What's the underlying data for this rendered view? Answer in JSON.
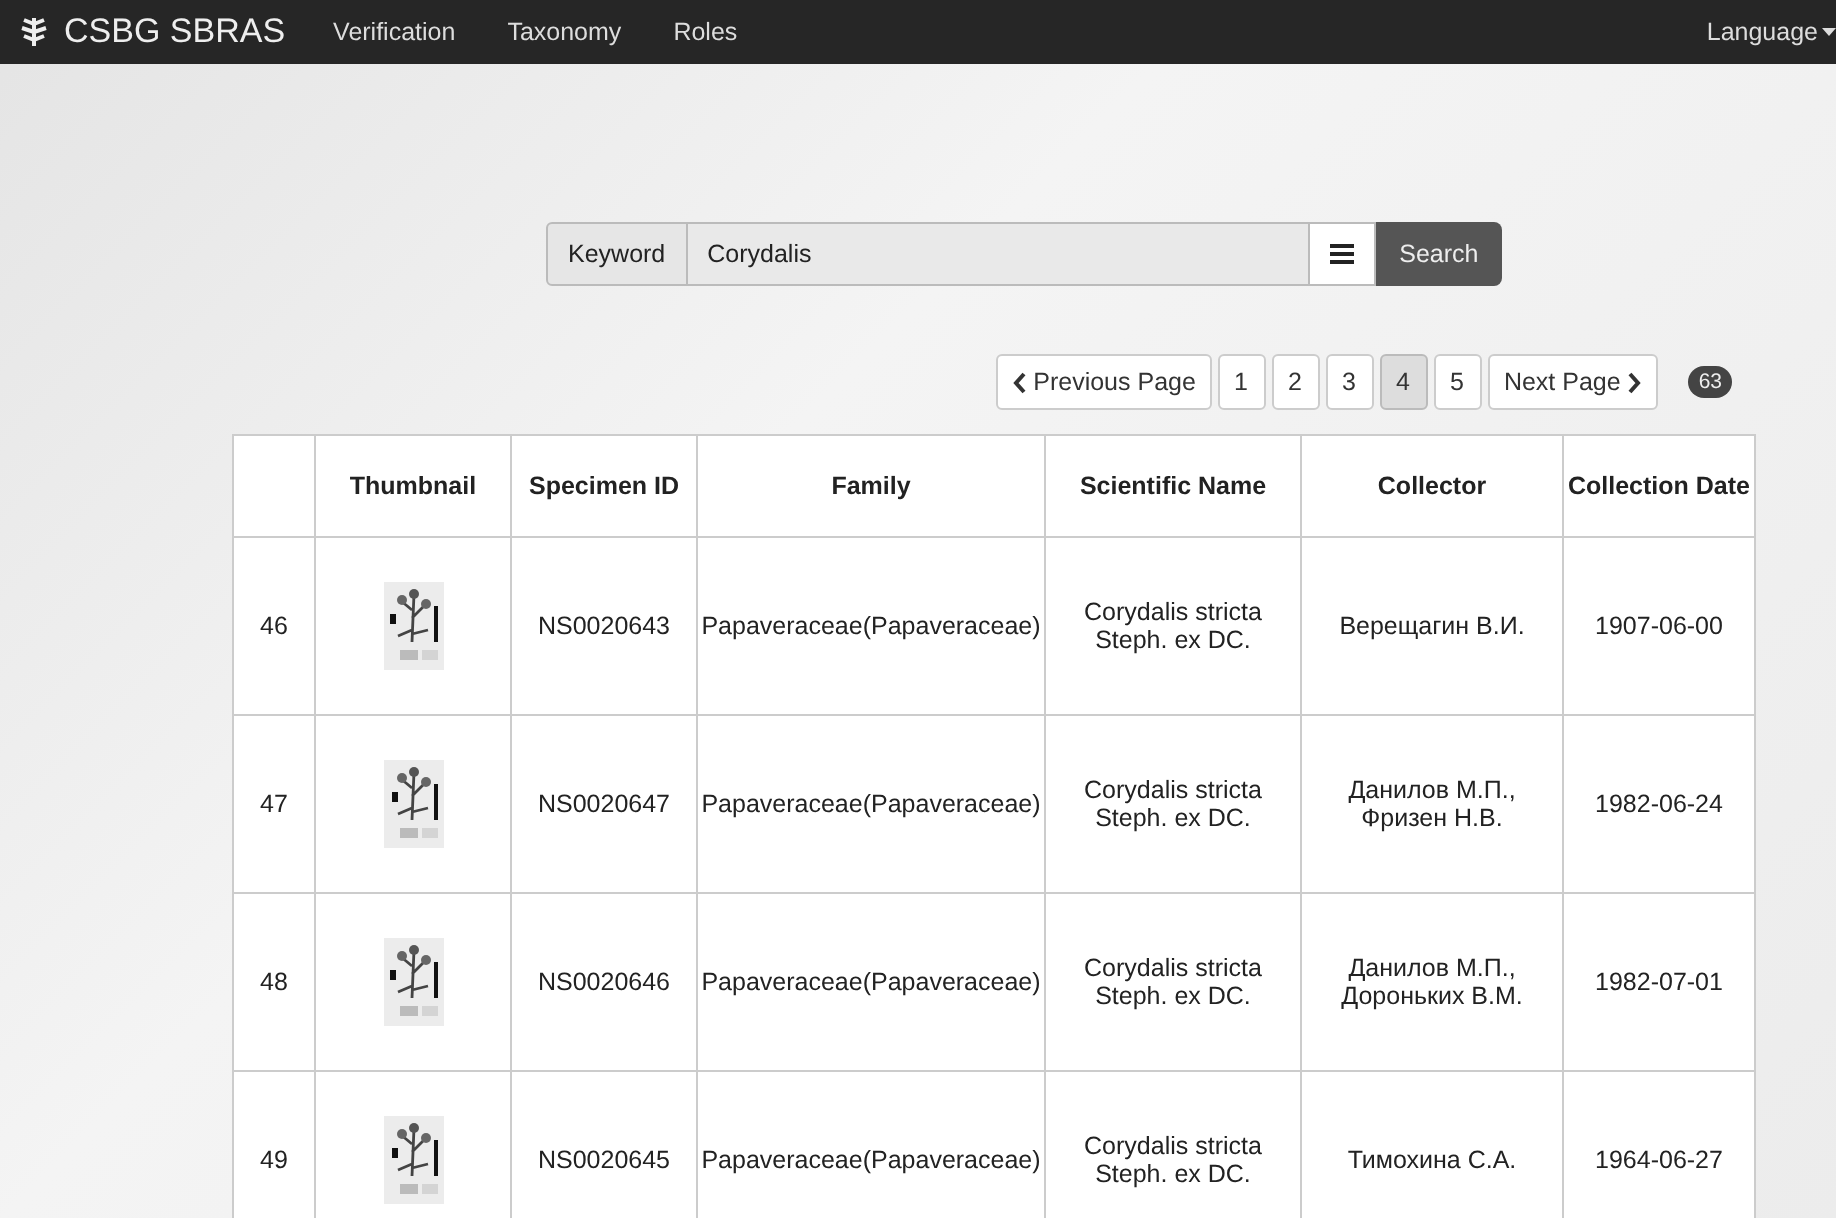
{
  "navbar": {
    "brand": "CSBG SBRAS",
    "links": [
      {
        "label": "Verification"
      },
      {
        "label": "Taxonomy"
      },
      {
        "label": "Roles"
      }
    ],
    "language": "Language"
  },
  "search": {
    "label": "Keyword",
    "value": "Corydalis",
    "button": "Search"
  },
  "pagination": {
    "previous": "Previous Page",
    "pages": [
      {
        "label": "1",
        "selected": false
      },
      {
        "label": "2",
        "selected": false
      },
      {
        "label": "3",
        "selected": false
      },
      {
        "label": "4",
        "selected": true
      },
      {
        "label": "5",
        "selected": false
      }
    ],
    "next": "Next Page",
    "count": "63"
  },
  "table": {
    "columns": [
      "",
      "Thumbnail",
      "Specimen ID",
      "Family",
      "Scientific Name",
      "Collector",
      "Collection Date"
    ],
    "rows": [
      {
        "number": "46",
        "specimen_id": "NS0020643",
        "family": "Papaveraceae(Papaveraceae)",
        "scientific_name": "Corydalis stricta Steph. ex DC.",
        "collector": "Верещагин В.И.",
        "date": "1907-06-00"
      },
      {
        "number": "47",
        "specimen_id": "NS0020647",
        "family": "Papaveraceae(Papaveraceae)",
        "scientific_name": "Corydalis stricta Steph. ex DC.",
        "collector": "Данилов М.П., Фризен Н.В.",
        "date": "1982-06-24"
      },
      {
        "number": "48",
        "specimen_id": "NS0020646",
        "family": "Papaveraceae(Papaveraceae)",
        "scientific_name": "Corydalis stricta Steph. ex DC.",
        "collector": "Данилов М.П., Дороньких В.М.",
        "date": "1982-07-01"
      },
      {
        "number": "49",
        "specimen_id": "NS0020645",
        "family": "Papaveraceae(Papaveraceae)",
        "scientific_name": "Corydalis stricta Steph. ex DC.",
        "collector": "Тимохина С.А.",
        "date": "1964-06-27"
      }
    ]
  }
}
